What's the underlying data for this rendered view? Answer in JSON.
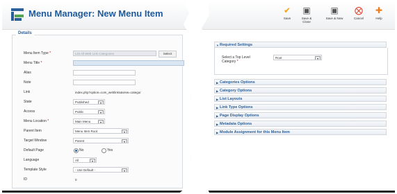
{
  "header": {
    "title": "Menu Manager: New Menu Item"
  },
  "details": {
    "legend": "Details",
    "fields": [
      {
        "label": "Menu Item Type",
        "required": true,
        "value": "List All Web Link Categories",
        "button": "Select"
      },
      {
        "label": "Menu Title",
        "required": true,
        "value": ""
      },
      {
        "label": "Alias",
        "required": false,
        "value": ""
      },
      {
        "label": "Note",
        "required": false,
        "value": ""
      },
      {
        "label": "Link",
        "required": false,
        "value": "index.php?option=com_weblinks&view=categor"
      },
      {
        "label": "State",
        "required": false,
        "value": "Published"
      },
      {
        "label": "Access",
        "required": false,
        "value": "Public"
      },
      {
        "label": "Menu Location",
        "required": true,
        "value": "Main Menu"
      },
      {
        "label": "Parent Item",
        "required": false,
        "value": "Menu Item Root"
      },
      {
        "label": "Target Window",
        "required": false,
        "value": "Parent"
      },
      {
        "label": "Default Page",
        "required": false,
        "options": [
          "No",
          "Yes"
        ],
        "selected": "No"
      },
      {
        "label": "Language",
        "required": false,
        "value": "All"
      },
      {
        "label": "Template Style",
        "required": false,
        "value": "- Use Default -"
      },
      {
        "label": "ID",
        "required": false,
        "value": "0"
      }
    ]
  },
  "toolbar": {
    "save": "Save",
    "save_close": "Save & Close",
    "save_new": "Save & New",
    "cancel": "Cancel",
    "help": "Help"
  },
  "required_settings": {
    "title": "Required Settings",
    "label": "Select a Top Level Category",
    "value": "Root"
  },
  "accordion": [
    "Categories Options",
    "Category Options",
    "List Layouts",
    "Link Type Options",
    "Page Display Options",
    "Metadata Options",
    "Module Assignment for this Menu Item"
  ],
  "colors": {
    "accent": "#2b5f9a",
    "save": "#f2a21a",
    "cancel": "#e0402b",
    "help": "#ef7d1a"
  }
}
